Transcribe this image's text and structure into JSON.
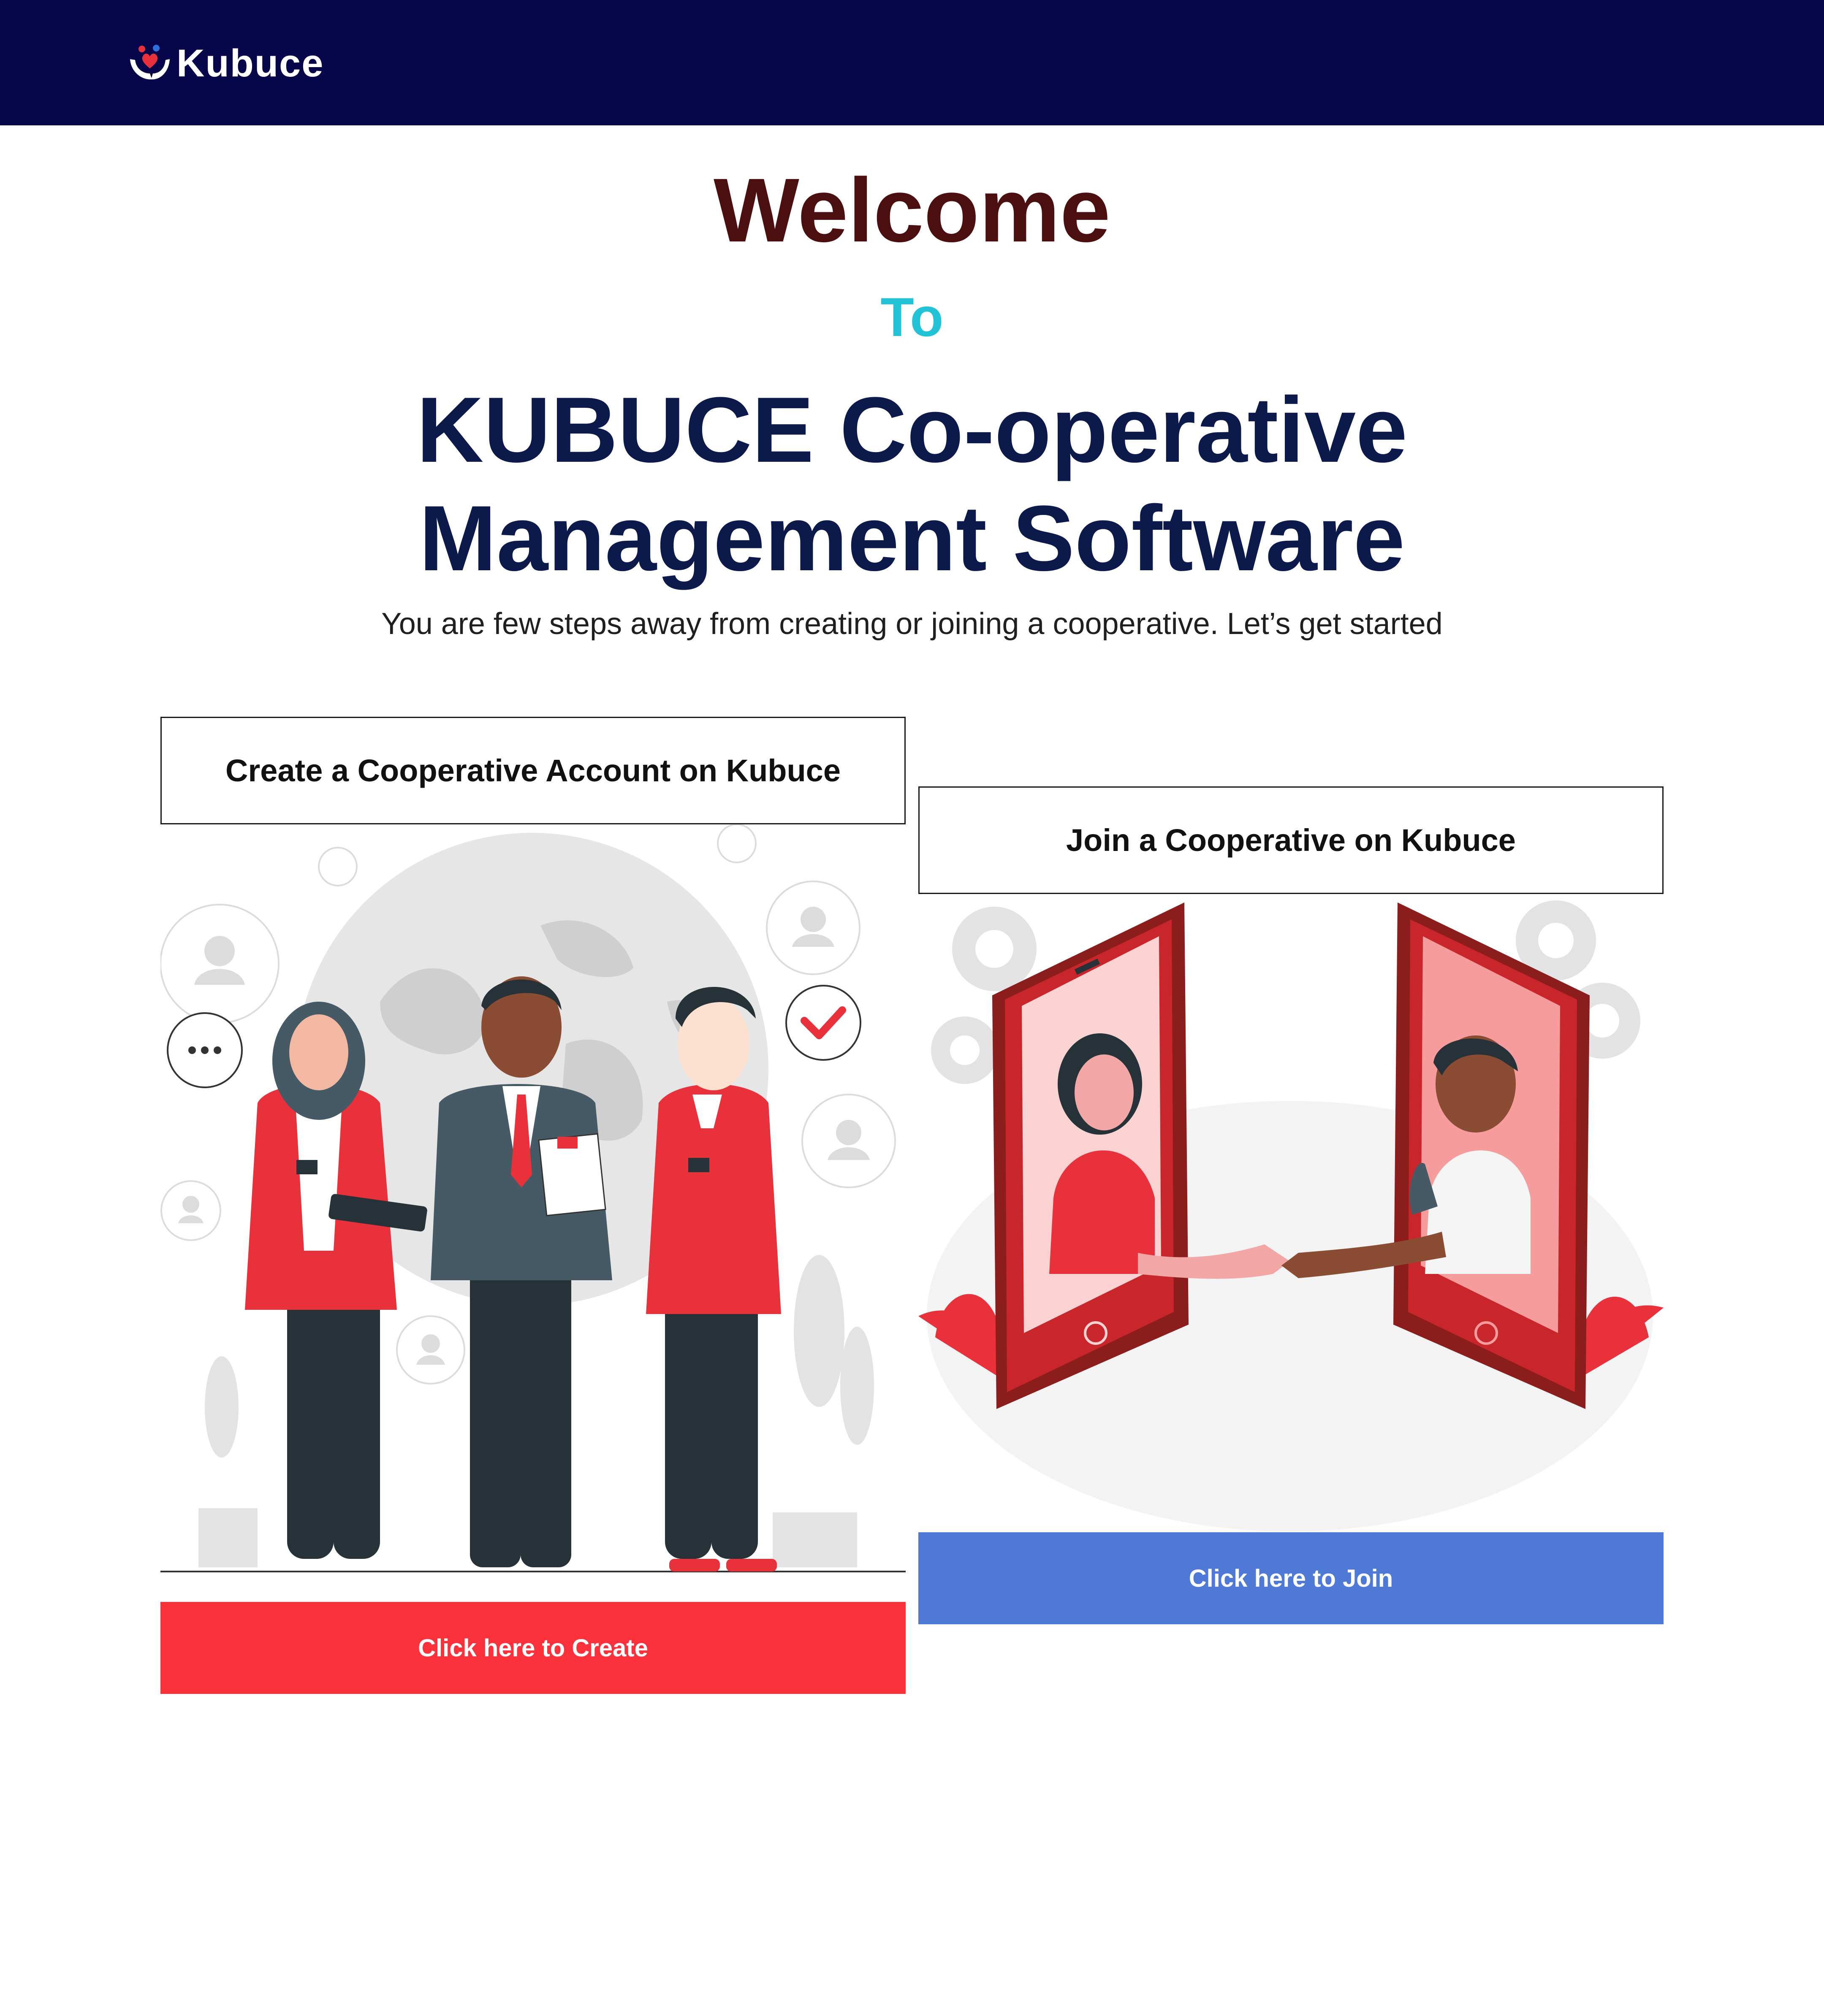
{
  "header": {
    "brand": "Kubuce",
    "logo_icon": "hands-heart-logo-icon"
  },
  "hero": {
    "welcome": "Welcome",
    "to": "To",
    "title": "KUBUCE Co-operative Management Software",
    "subtitle": "You are few steps away from creating or joining a cooperative. Let’s get started"
  },
  "create_card": {
    "heading": "Create a Cooperative Account on Kubuce",
    "illustration": "team-meeting-illustration",
    "button_label": "Click here to Create"
  },
  "join_card": {
    "heading": "Join a Cooperative on Kubuce",
    "illustration": "phone-handshake-illustration",
    "button_label": "Click here to Join"
  },
  "colors": {
    "header_bg": "#07064a",
    "welcome": "#4b0f10",
    "to": "#22c3d6",
    "title": "#0b1a4a",
    "create_button": "#fb323b",
    "join_button": "#4f79d6",
    "accent_red": "#e8313a"
  }
}
